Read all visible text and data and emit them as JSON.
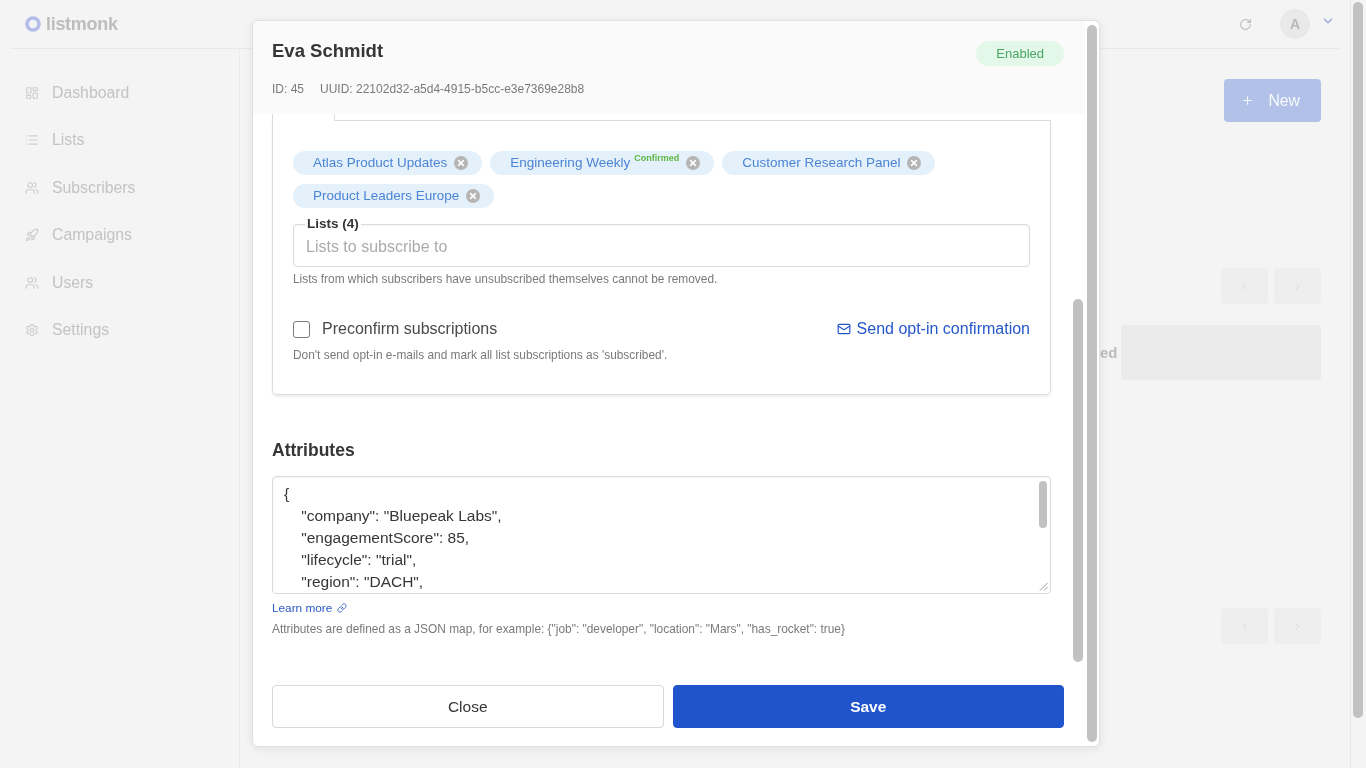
{
  "app": {
    "logo": "listmonk",
    "avatar": "A"
  },
  "sidebar": {
    "items": [
      {
        "label": "Dashboard"
      },
      {
        "label": "Lists"
      },
      {
        "label": "Subscribers"
      },
      {
        "label": "Campaigns"
      },
      {
        "label": "Users"
      },
      {
        "label": "Settings"
      }
    ]
  },
  "page": {
    "new_button": "New",
    "heading_fragment": "ed"
  },
  "modal": {
    "title": "Eva Schmidt",
    "status": {
      "label": "Enabled",
      "kind": "enabled"
    },
    "id": "ID: 45",
    "uuid": "UUID: 22102d32-a5d4-4915-b5cc-e3e7369e28b8",
    "lists": [
      {
        "name": "Atlas Product Updates"
      },
      {
        "name": "Engineering Weekly",
        "status": "Confirmed"
      },
      {
        "name": "Customer Research Panel"
      },
      {
        "name": "Product Leaders Europe"
      }
    ],
    "lists_field": {
      "label": "Lists (4)",
      "placeholder": "Lists to subscribe to",
      "help": "Lists from which subscribers have unsubscribed themselves cannot be removed."
    },
    "preconfirm": {
      "label": "Preconfirm subscriptions",
      "checked": false,
      "help": "Don't send opt-in e-mails and mark all list subscriptions as 'subscribed'."
    },
    "send_optin_link": "Send opt-in confirmation",
    "attributes": {
      "heading": "Attributes",
      "value": "{\n    \"company\": \"Bluepeak Labs\",\n    \"engagementScore\": 85,\n    \"lifecycle\": \"trial\",\n    \"region\": \"DACH\",",
      "learn_more": "Learn more",
      "help": "Attributes are defined as a JSON map, for example: {\"job\": \"developer\", \"location\": \"Mars\", \"has_rocket\": true}"
    },
    "buttons": [
      {
        "label": "Close",
        "kind": "outline"
      },
      {
        "label": "Save",
        "kind": "primary"
      }
    ]
  }
}
